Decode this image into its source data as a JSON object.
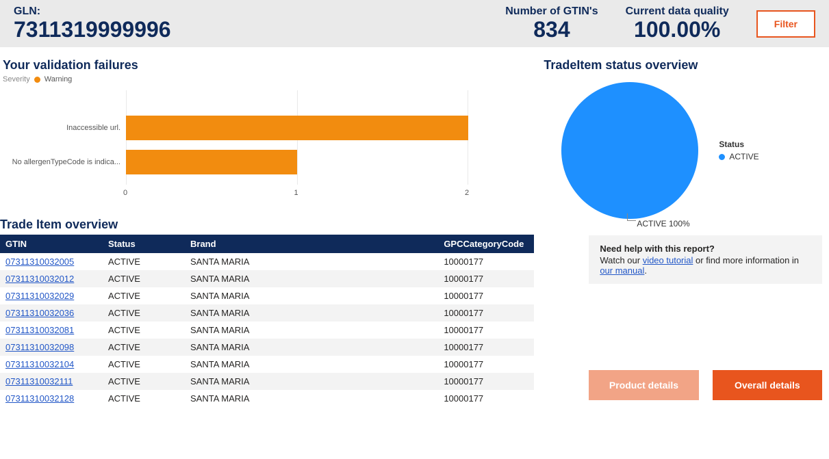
{
  "header": {
    "gln_label": "GLN:",
    "gln_value": "7311319999996",
    "gtin_count_label": "Number of GTIN's",
    "gtin_count_value": "834",
    "quality_label": "Current data quality",
    "quality_value": "100.00%",
    "filter_label": "Filter"
  },
  "failures": {
    "title": "Your validation failures",
    "legend_label": "Severity",
    "legend_series": "Warning"
  },
  "status_overview": {
    "title": "TradeItem status overview",
    "legend_title": "Status",
    "legend_item": "ACTIVE",
    "callout": "ACTIVE 100%"
  },
  "trade_overview": {
    "title": "Trade Item overview",
    "columns": {
      "c0": "GTIN",
      "c1": "Status",
      "c2": "Brand",
      "c3": "GPCCategoryCode"
    }
  },
  "help": {
    "title": "Need help with this report?",
    "prefix": "Watch our ",
    "link1": "video tutorial",
    "mid": " or find more information in",
    "link2": " our manual",
    "suffix": "."
  },
  "buttons": {
    "product_details": "Product details",
    "overall_details": "Overall details"
  },
  "chart_data": [
    {
      "type": "bar",
      "orientation": "horizontal",
      "title": "Your validation failures",
      "legend": [
        "Warning"
      ],
      "categories": [
        "Inaccessible url.",
        "No allergenTypeCode is indica..."
      ],
      "values": [
        2,
        1
      ],
      "xlabel": "",
      "ylabel": "",
      "xlim": [
        0,
        2
      ],
      "xticks": [
        0,
        1,
        2
      ],
      "color": "#f28c0f"
    },
    {
      "type": "pie",
      "title": "TradeItem status overview",
      "series": [
        {
          "name": "ACTIVE",
          "value": 100
        }
      ],
      "colors": [
        "#1e90ff"
      ],
      "annotations": [
        "ACTIVE 100%"
      ]
    }
  ],
  "trade_rows": [
    {
      "gtin": "07311310032005",
      "status": "ACTIVE",
      "brand": "SANTA MARIA",
      "gpc": "10000177"
    },
    {
      "gtin": "07311310032012",
      "status": "ACTIVE",
      "brand": "SANTA MARIA",
      "gpc": "10000177"
    },
    {
      "gtin": "07311310032029",
      "status": "ACTIVE",
      "brand": "SANTA MARIA",
      "gpc": "10000177"
    },
    {
      "gtin": "07311310032036",
      "status": "ACTIVE",
      "brand": "SANTA MARIA",
      "gpc": "10000177"
    },
    {
      "gtin": "07311310032081",
      "status": "ACTIVE",
      "brand": "SANTA MARIA",
      "gpc": "10000177"
    },
    {
      "gtin": "07311310032098",
      "status": "ACTIVE",
      "brand": "SANTA MARIA",
      "gpc": "10000177"
    },
    {
      "gtin": "07311310032104",
      "status": "ACTIVE",
      "brand": "SANTA MARIA",
      "gpc": "10000177"
    },
    {
      "gtin": "07311310032111",
      "status": "ACTIVE",
      "brand": "SANTA MARIA",
      "gpc": "10000177"
    },
    {
      "gtin": "07311310032128",
      "status": "ACTIVE",
      "brand": "SANTA MARIA",
      "gpc": "10000177"
    }
  ]
}
